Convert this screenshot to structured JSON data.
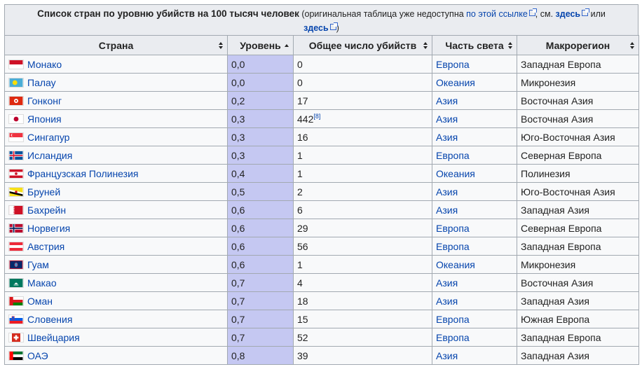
{
  "caption": {
    "title": "Список стран по уровню убийств на 100 тысяч человек",
    "note_prefix": " (оригинальная таблица уже недоступна ",
    "link1": "по этой ссылке",
    "note_mid": ", см. ",
    "link2": "здесь",
    "note_or": " или",
    "link3": "здесь",
    "note_end": ")"
  },
  "columns": [
    "Страна",
    "Уровень",
    "Общее число убийств",
    "Часть света",
    "Макрорегион"
  ],
  "rows": [
    {
      "country": "Монако",
      "rate": "0,0",
      "total": "0",
      "cite": "",
      "region": "Европа",
      "macro": "Западная Европа",
      "flag": "monaco"
    },
    {
      "country": "Палау",
      "rate": "0,0",
      "total": "0",
      "cite": "",
      "region": "Океания",
      "macro": "Микронезия",
      "flag": "palau"
    },
    {
      "country": "Гонконг",
      "rate": "0,2",
      "total": "17",
      "cite": "",
      "region": "Азия",
      "macro": "Восточная Азия",
      "flag": "hongkong"
    },
    {
      "country": "Япония",
      "rate": "0,3",
      "total": "442",
      "cite": "[8]",
      "region": "Азия",
      "macro": "Восточная Азия",
      "flag": "japan"
    },
    {
      "country": "Сингапур",
      "rate": "0,3",
      "total": "16",
      "cite": "",
      "region": "Азия",
      "macro": "Юго-Восточная Азия",
      "flag": "singapore"
    },
    {
      "country": "Исландия",
      "rate": "0,3",
      "total": "1",
      "cite": "",
      "region": "Европа",
      "macro": "Северная Европа",
      "flag": "iceland"
    },
    {
      "country": "Французская Полинезия",
      "rate": "0,4",
      "total": "1",
      "cite": "",
      "region": "Океания",
      "macro": "Полинезия",
      "flag": "frpolynesia"
    },
    {
      "country": "Бруней",
      "rate": "0,5",
      "total": "2",
      "cite": "",
      "region": "Азия",
      "macro": "Юго-Восточная Азия",
      "flag": "brunei"
    },
    {
      "country": "Бахрейн",
      "rate": "0,6",
      "total": "6",
      "cite": "",
      "region": "Азия",
      "macro": "Западная Азия",
      "flag": "bahrain"
    },
    {
      "country": "Норвегия",
      "rate": "0,6",
      "total": "29",
      "cite": "",
      "region": "Европа",
      "macro": "Северная Европа",
      "flag": "norway"
    },
    {
      "country": "Австрия",
      "rate": "0,6",
      "total": "56",
      "cite": "",
      "region": "Европа",
      "macro": "Западная Европа",
      "flag": "austria"
    },
    {
      "country": "Гуам",
      "rate": "0,6",
      "total": "1",
      "cite": "",
      "region": "Океания",
      "macro": "Микронезия",
      "flag": "guam"
    },
    {
      "country": "Макао",
      "rate": "0,7",
      "total": "4",
      "cite": "",
      "region": "Азия",
      "macro": "Восточная Азия",
      "flag": "macao"
    },
    {
      "country": "Оман",
      "rate": "0,7",
      "total": "18",
      "cite": "",
      "region": "Азия",
      "macro": "Западная Азия",
      "flag": "oman"
    },
    {
      "country": "Словения",
      "rate": "0,7",
      "total": "15",
      "cite": "",
      "region": "Европа",
      "macro": "Южная Европа",
      "flag": "slovenia"
    },
    {
      "country": "Швейцария",
      "rate": "0,7",
      "total": "52",
      "cite": "",
      "region": "Европа",
      "macro": "Западная Европа",
      "flag": "switzerland"
    },
    {
      "country": "ОАЭ",
      "rate": "0,8",
      "total": "39",
      "cite": "",
      "region": "Азия",
      "macro": "Западная Азия",
      "flag": "uae"
    }
  ],
  "colors": {
    "link": "#0645ad",
    "header_bg": "#eaecf0",
    "rate_col": "#c5c8f2",
    "border": "#a2a9b1"
  }
}
